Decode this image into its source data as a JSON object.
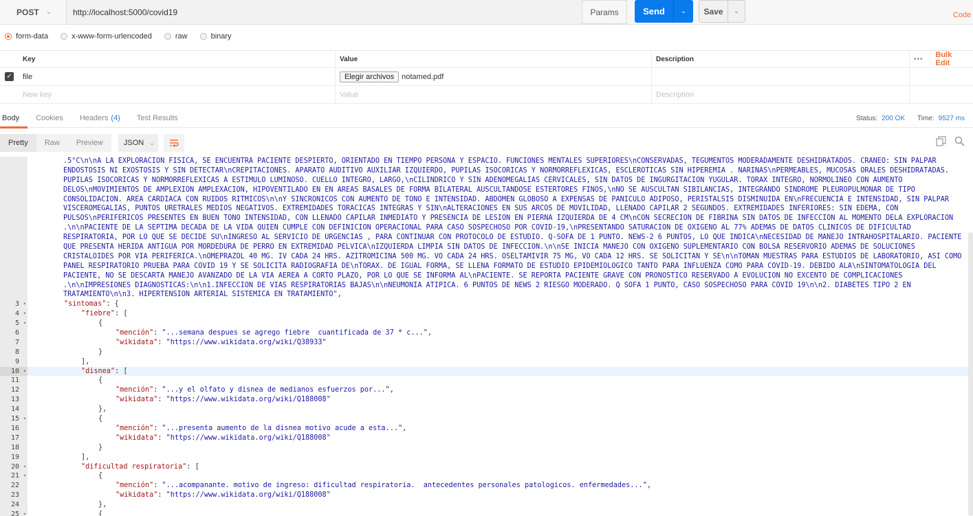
{
  "request": {
    "method": "POST",
    "url": "http://localhost:5000/covid19",
    "params_label": "Params",
    "send_label": "Send",
    "save_label": "Save",
    "code_label": "Code"
  },
  "body_types": [
    "form-data",
    "x-www-form-urlencoded",
    "raw",
    "binary"
  ],
  "form_table": {
    "headers": {
      "key": "Key",
      "value": "Value",
      "description": "Description",
      "bulk_edit": "Bulk Edit"
    },
    "row": {
      "key": "file",
      "file_button": "Elegir archivos",
      "file_name": "notamed.pdf"
    },
    "placeholders": {
      "key": "New key",
      "value": "Value",
      "description": "Description"
    }
  },
  "response_tabs": {
    "body": "Body",
    "cookies": "Cookies",
    "headers": "Headers",
    "headers_count": "(4)",
    "tests": "Test Results"
  },
  "status": {
    "status_label": "Status:",
    "status_value": "200 OK",
    "time_label": "Time:",
    "time_value": "9527 ms"
  },
  "view_modes": [
    "Pretty",
    "Raw",
    "Preview"
  ],
  "format": "JSON",
  "code": {
    "wrapped": [
      ".5°C\\n\\nA LA EXPLORACION FISICA, SE ENCUENTRA PACIENTE DESPIERTO, ORIENTADO EN TIEMPO PERSONA Y ESPACIO. FUNCIONES MENTALES SUPERIORES\\nCONSERVADAS, TEGUMENTOS MODERADAMENTE DESHIDRATADOS. CRANEO: SIN PALPAR",
      "ENDOSTOSIS NI EXOSTOSIS Y SIN DETECTAR\\nCREPITACIONES. APARATO AUDITIVO AUXILIAR IZQUIERDO, PUPILAS ISOCORICAS Y NORMORREFLEXICAS, ESCLEROTICAS SIN HIPEREMIA . NARINAS\\nPERMEABLES, MUCOSAS ORALES DESHIDRATADAS.",
      "PUPILAS ISOCORICAS Y NORMORREFLEXICAS A ESTIMULO LUMINOSO. CUELLO INTEGRO, LARGO,\\nCILINDRICO Y SIN ADENOMEGALIAS CERVICALES, SIN DATOS DE INGURGITACION YUGULAR. TORAX INTEGRO, NORMOLINEO CON AUMENTO",
      "DELOS\\nMOVIMIENTOS DE AMPLEXION AMPLEXACION, HIPOVENTILADO EN EN AREAS BASALES DE FORMA BILATERAL AUSCULTANDOSE ESTERTORES FINOS,\\nNO SE AUSCULTAN SIBILANCIAS, INTEGRANDO SINDROME PLEUROPULMONAR DE TIPO",
      "CONSOLIDACION. AREA CARDIACA CON RUIDOS RITMICOS\\n\\nY SINCRONICOS CON AUMENTO DE TONO E INTENSIDAD. ABDOMEN GLOBOSO A EXPENSAS DE PANICULO ADIPOSO, PERISTALSIS DISMINUIDA EN\\nFRECUENCIA E INTENSIDAD, SIN PALPAR",
      "VISCEROMEGALIAS, PUNTOS URETRALES MEDIOS NEGATIVOS. EXTREMIDADES TORACICAS INTEGRAS Y SIN\\nALTERACIONES EN SUS ARCOS DE MOVILIDAD, LLENADO CAPILAR 2 SEGUNDOS. EXTREMIDADES INFERIORES: SIN EDEMA, CON",
      "PULSOS\\nPERIFERICOS PRESENTES EN BUEN TONO INTENSIDAD, CON LLENADO CAPILAR INMEDIATO Y PRESENCIA DE LESION EN PIERNA IZQUIERDA DE 4 CM\\nCON SECRECION DE FIBRINA SIN DATOS DE INFECCION AL MOMENTO DELA EXPLORACION",
      ".\\n\\nPACIENTE DE LA SEPTIMA DECADA DE LA VIDA QUIEN CUMPLE CON DEFINICION OPERACIONAL PARA CASO SOSPECHOSO POR COVID-19,\\nPRESENTANDO SATURACION DE OXIGENO AL 77% ADEMAS DE DATOS CLINICOS DE DIFICULTAD",
      "RESPIRATORIA, POR LO QUE SE DECIDE SU\\nINGRESO AL SERVICIO DE URGENCIAS , PARA CONTINUAR CON PROTOCOLO DE ESTUDIO. Q-SOFA DE 1 PUNTO. NEWS-2 6 PUNTOS, LO QUE INDICA\\nNECESIDAD DE MANEJO INTRAHOSPITALARIO. PACIENTE",
      "QUE PRESENTA HERIDA ANTIGUA POR MORDEDURA DE PERRO EN EXTREMIDAD PELVICA\\nIZQUIERDA LIMPIA SIN DATOS DE INFECCION.\\n\\nSE INICIA MANEJO CON OXIGENO SUPLEMENTARIO CON BOLSA RESERVORIO ADEMAS DE SOLUCIONES",
      "CRISTALOIDES POR VIA PERIFERICA.\\nOMEPRAZOL 40 MG. IV CADA 24 HRS. AZITROMICINA 500 MG. VO CADA 24 HRS. OSELTAMIVIR 75 MG, VO CADA 12 HRS. SE SOLICITAN Y SE\\n\\nTOMAN MUESTRAS PARA ESTUDIOS DE LABORATORIO, ASI COMO",
      "PANEL RESPIRATORIO PRUEBA PARA COVID 19 Y SE SOLICITA RADIOGRAFIA DE\\nTORAX. DE IGUAL FORMA, SE LLENA FORMATO DE ESTUDIO EPIDEMIOLOGICO TANTO PARA INFLUENZA COMO PARA COVID-19. DEBIDO ALA\\nSINTOMATOLOGIA DEL",
      "PACIENTE, NO SE DESCARTA MANEJO AVANZADO DE LA VIA AEREA A CORTO PLAZO, POR LO QUE SE INFORMA AL\\nPACIENTE. SE REPORTA PACIENTE GRAVE CON PRONOSTICO RESERVADO A EVOLUCION NO EXCENTO DE COMPLICACIONES",
      ".\\n\\nIMPRESIONES DIAGNOSTICAS:\\n\\n1.INFECCION DE VIAS RESPIRATORIAS BAJAS\\n\\nNEUMONIA ATIPICA. 6 PUNTOS DE NEWS 2 RIESGO MODERADO. Q SOFA 1 PUNTO, CASO SOSPECHOSO PARA COVID 19\\n\\n2. DIABETES TIPO 2 EN",
      "TRATAMIENTO\\n\\n3. HIPERTENSION ARTERIAL SISTEMICA EN TRATAMIENTO\","
    ],
    "lines": [
      {
        "n": "3",
        "indent": 1,
        "text": "\"sintomas\": {",
        "fold": true
      },
      {
        "n": "4",
        "indent": 2,
        "text": "\"fiebre\": [",
        "fold": true
      },
      {
        "n": "5",
        "indent": 3,
        "text": "{",
        "fold": true
      },
      {
        "n": "6",
        "indent": 4,
        "text": "\"mención\": \"...semana despues se agrego fiebre  cuantificada de 37 * c...\",",
        "fold": false
      },
      {
        "n": "7",
        "indent": 4,
        "text": "\"wikidata\": \"https://www.wikidata.org/wiki/Q38933\"",
        "fold": false
      },
      {
        "n": "8",
        "indent": 3,
        "text": "}",
        "fold": false
      },
      {
        "n": "9",
        "indent": 2,
        "text": "],",
        "fold": false
      },
      {
        "n": "10",
        "indent": 2,
        "text": "\"disnea\": [",
        "fold": true,
        "active": true
      },
      {
        "n": "11",
        "indent": 3,
        "text": "{",
        "fold": false
      },
      {
        "n": "12",
        "indent": 4,
        "text": "\"mención\": \"...y el olfato y disnea de medianos esfuerzos por...\",",
        "fold": false
      },
      {
        "n": "13",
        "indent": 4,
        "text": "\"wikidata\": \"https://www.wikidata.org/wiki/Q188008\"",
        "fold": false
      },
      {
        "n": "14",
        "indent": 3,
        "text": "},",
        "fold": false
      },
      {
        "n": "15",
        "indent": 3,
        "text": "{",
        "fold": true
      },
      {
        "n": "16",
        "indent": 4,
        "text": "\"mención\": \"...presenta aumento de la disnea motivo acude a esta...\",",
        "fold": false
      },
      {
        "n": "17",
        "indent": 4,
        "text": "\"wikidata\": \"https://www.wikidata.org/wiki/Q188008\"",
        "fold": false
      },
      {
        "n": "18",
        "indent": 3,
        "text": "}",
        "fold": false
      },
      {
        "n": "19",
        "indent": 2,
        "text": "],",
        "fold": false
      },
      {
        "n": "20",
        "indent": 2,
        "text": "\"dificultad respiratoria\": [",
        "fold": true
      },
      {
        "n": "21",
        "indent": 3,
        "text": "{",
        "fold": true
      },
      {
        "n": "22",
        "indent": 4,
        "text": "\"mención\": \"...acompanante. motivo de ingreso: dificultad respiratoria.  antecedentes personales patologicos. enfermedades...\",",
        "fold": false
      },
      {
        "n": "23",
        "indent": 4,
        "text": "\"wikidata\": \"https://www.wikidata.org/wiki/Q188008\"",
        "fold": false
      },
      {
        "n": "24",
        "indent": 3,
        "text": "},",
        "fold": false
      },
      {
        "n": "25",
        "indent": 3,
        "text": "{",
        "fold": true
      }
    ]
  },
  "icons": {
    "method_caret": "chevron-down-icon",
    "copy": "copy-icon",
    "search": "search-icon",
    "wrap": "wrap-lines-icon"
  },
  "colors": {
    "accent": "#f26b3a",
    "send": "#097bed",
    "link": "#2b7dd1"
  }
}
